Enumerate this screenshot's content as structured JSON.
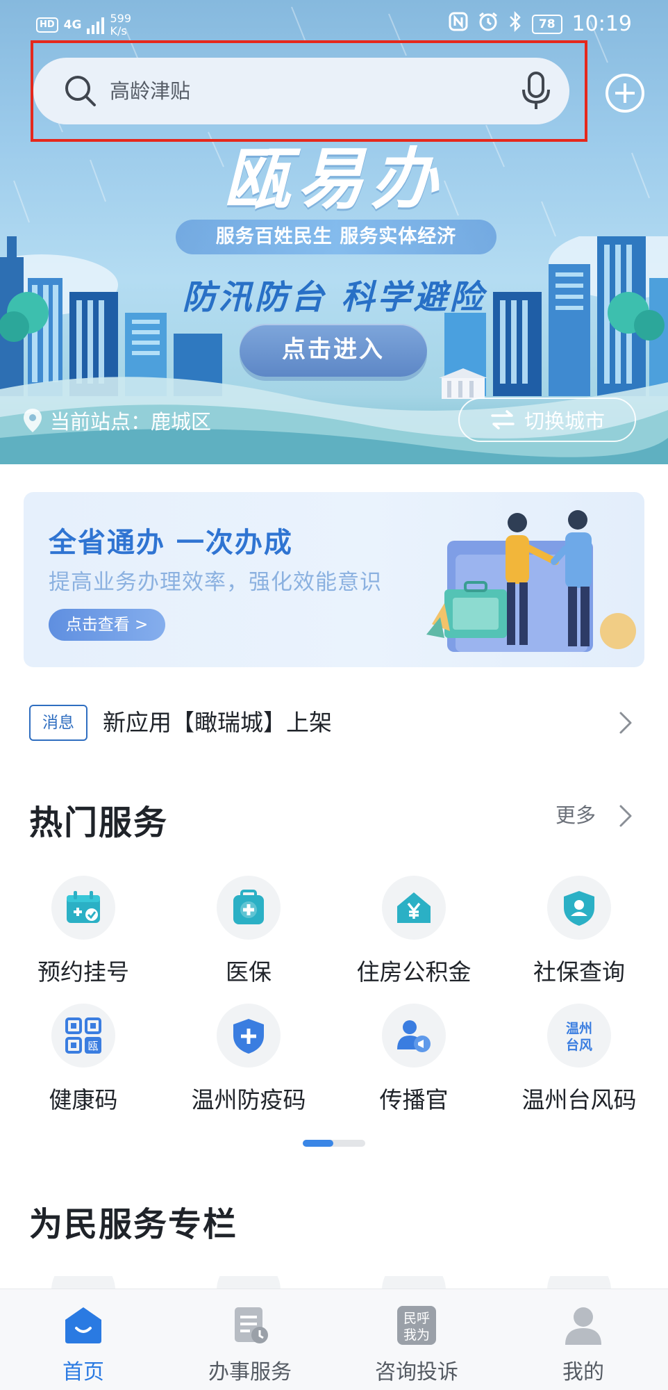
{
  "status_bar": {
    "hd": "HD",
    "network": "4G",
    "speed_value": "599",
    "speed_unit": "K/s",
    "battery": "78",
    "time": "10:19"
  },
  "search": {
    "placeholder": "高龄津贴"
  },
  "banner": {
    "brand": "瓯易办",
    "slogan": "服务百姓民生  服务实体经济",
    "campaign": "防汛防台 科学避险",
    "enter_label": "点击进入"
  },
  "location": {
    "label": "当前站点：鹿城区",
    "switch_label": "切换城市"
  },
  "promo": {
    "title": "全省通办 一次办成",
    "subtitle": "提高业务办理效率，强化效能意识",
    "button_label": "点击查看 >"
  },
  "notice": {
    "tag": "消息",
    "text": "新应用【瞰瑞城】上架"
  },
  "hot_services": {
    "title": "热门服务",
    "more_label": "更多",
    "items": [
      {
        "label": "预约挂号",
        "icon": "calendar-check-icon"
      },
      {
        "label": "医保",
        "icon": "medical-kit-icon"
      },
      {
        "label": "住房公积金",
        "icon": "house-yuan-icon"
      },
      {
        "label": "社保查询",
        "icon": "shield-user-icon"
      },
      {
        "label": "健康码",
        "icon": "qr-code-icon"
      },
      {
        "label": "温州防疫码",
        "icon": "shield-plus-icon"
      },
      {
        "label": "传播官",
        "icon": "person-megaphone-icon"
      },
      {
        "label": "温州台风码",
        "icon": "typhoon-code-icon"
      }
    ],
    "typhoon_icon_text": "温州台风",
    "qr_icon_text": "瓯"
  },
  "people_section": {
    "title": "为民服务专栏"
  },
  "bottom_nav": {
    "items": [
      {
        "label": "首页",
        "icon": "home-icon",
        "active": true
      },
      {
        "label": "办事服务",
        "icon": "document-clock-icon",
        "active": false
      },
      {
        "label": "咨询投诉",
        "icon": "people-call-icon",
        "active": false,
        "icon_text": "民呼我为"
      },
      {
        "label": "我的",
        "icon": "user-icon",
        "active": false
      }
    ]
  },
  "colors": {
    "accent": "#2a7ae2",
    "highlight_border": "#e5281c",
    "promo_title": "#2f74d2"
  }
}
